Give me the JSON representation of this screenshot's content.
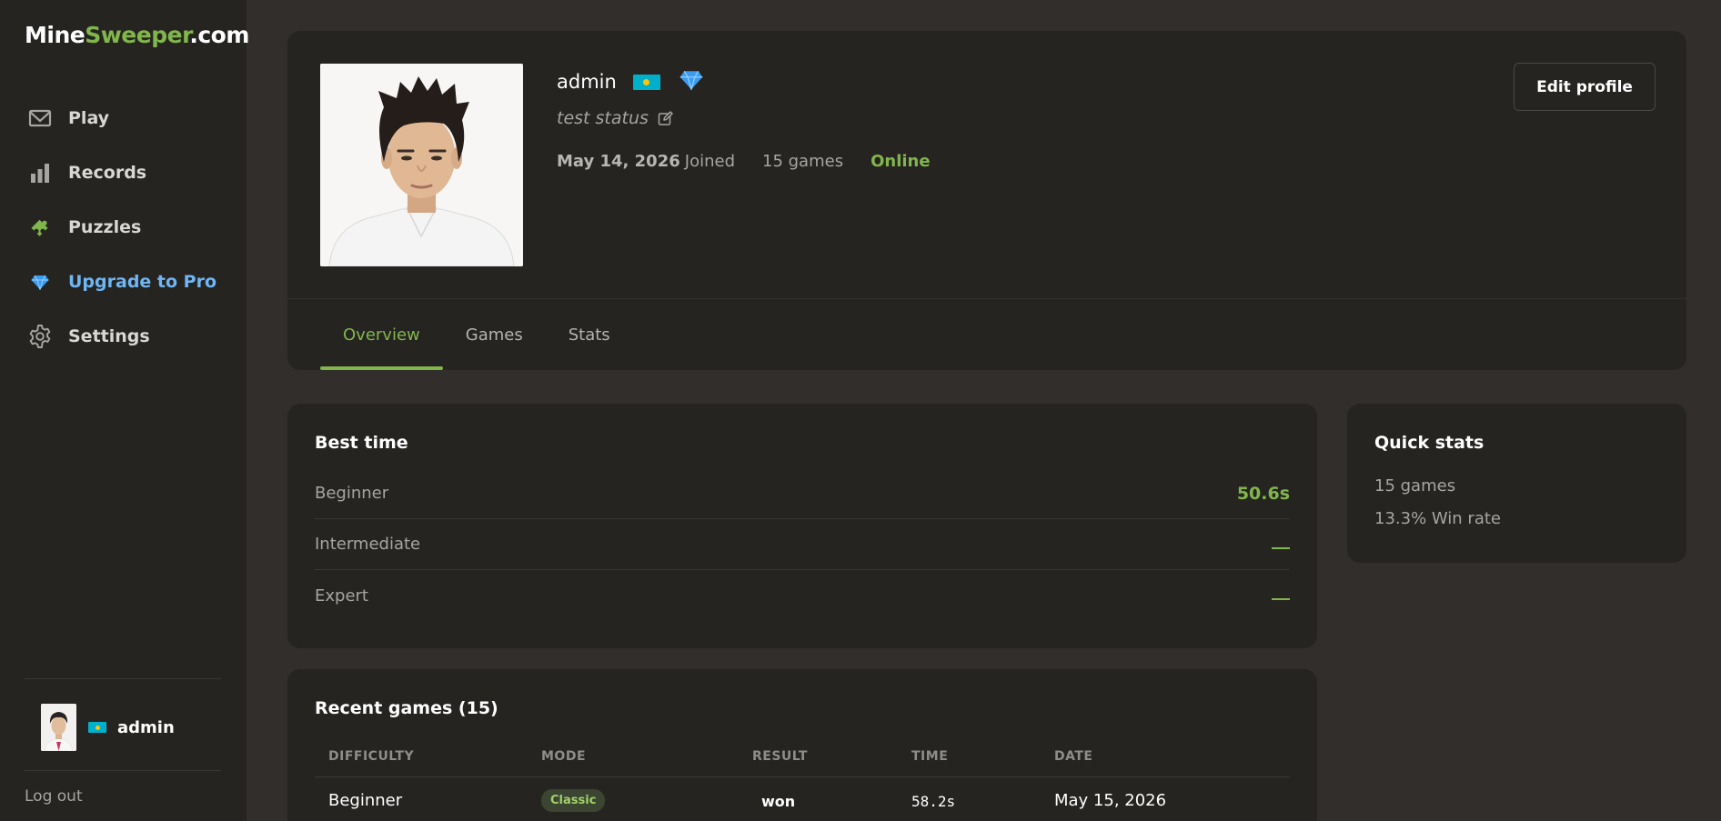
{
  "app": {
    "logo_part1": "Mine",
    "logo_part2": "Sweeper",
    "logo_part3": ".com"
  },
  "sidebar": {
    "items": [
      {
        "label": "Play",
        "icon": "envelope-play-icon"
      },
      {
        "label": "Records",
        "icon": "bar-chart-icon"
      },
      {
        "label": "Puzzles",
        "icon": "puzzle-icon"
      },
      {
        "label": "Upgrade to Pro",
        "icon": "diamond-icon"
      },
      {
        "label": "Settings",
        "icon": "gear-icon"
      }
    ],
    "user_name": "admin",
    "logout_label": "Log out"
  },
  "profile": {
    "username": "admin",
    "flag": "kazakhstan-flag",
    "badge": "diamond-icon",
    "status": "test status",
    "joined_date": "May 14, 2026",
    "joined_label": "Joined",
    "games_count": "15 games",
    "online_status": "Online",
    "edit_button": "Edit profile",
    "tabs": [
      "Overview",
      "Games",
      "Stats"
    ],
    "active_tab": "Overview"
  },
  "best_time": {
    "title": "Best time",
    "rows": [
      {
        "label": "Beginner",
        "value": "50.6s"
      },
      {
        "label": "Intermediate",
        "value": "—"
      },
      {
        "label": "Expert",
        "value": "—"
      }
    ]
  },
  "quick_stats": {
    "title": "Quick stats",
    "games": "15 games",
    "win_rate": "13.3% Win rate"
  },
  "recent_games": {
    "title": "Recent games (15)",
    "columns": [
      "DIFFICULTY",
      "MODE",
      "RESULT",
      "TIME",
      "DATE"
    ],
    "rows": [
      {
        "difficulty": "Beginner",
        "mode": "Classic",
        "result": "won",
        "time": "58.2s",
        "date": "May 15, 2026"
      }
    ]
  },
  "colors": {
    "accent_green": "#81b64c",
    "pro_blue": "#6eb6f5",
    "background": "#312e2b",
    "panel": "#262421"
  }
}
